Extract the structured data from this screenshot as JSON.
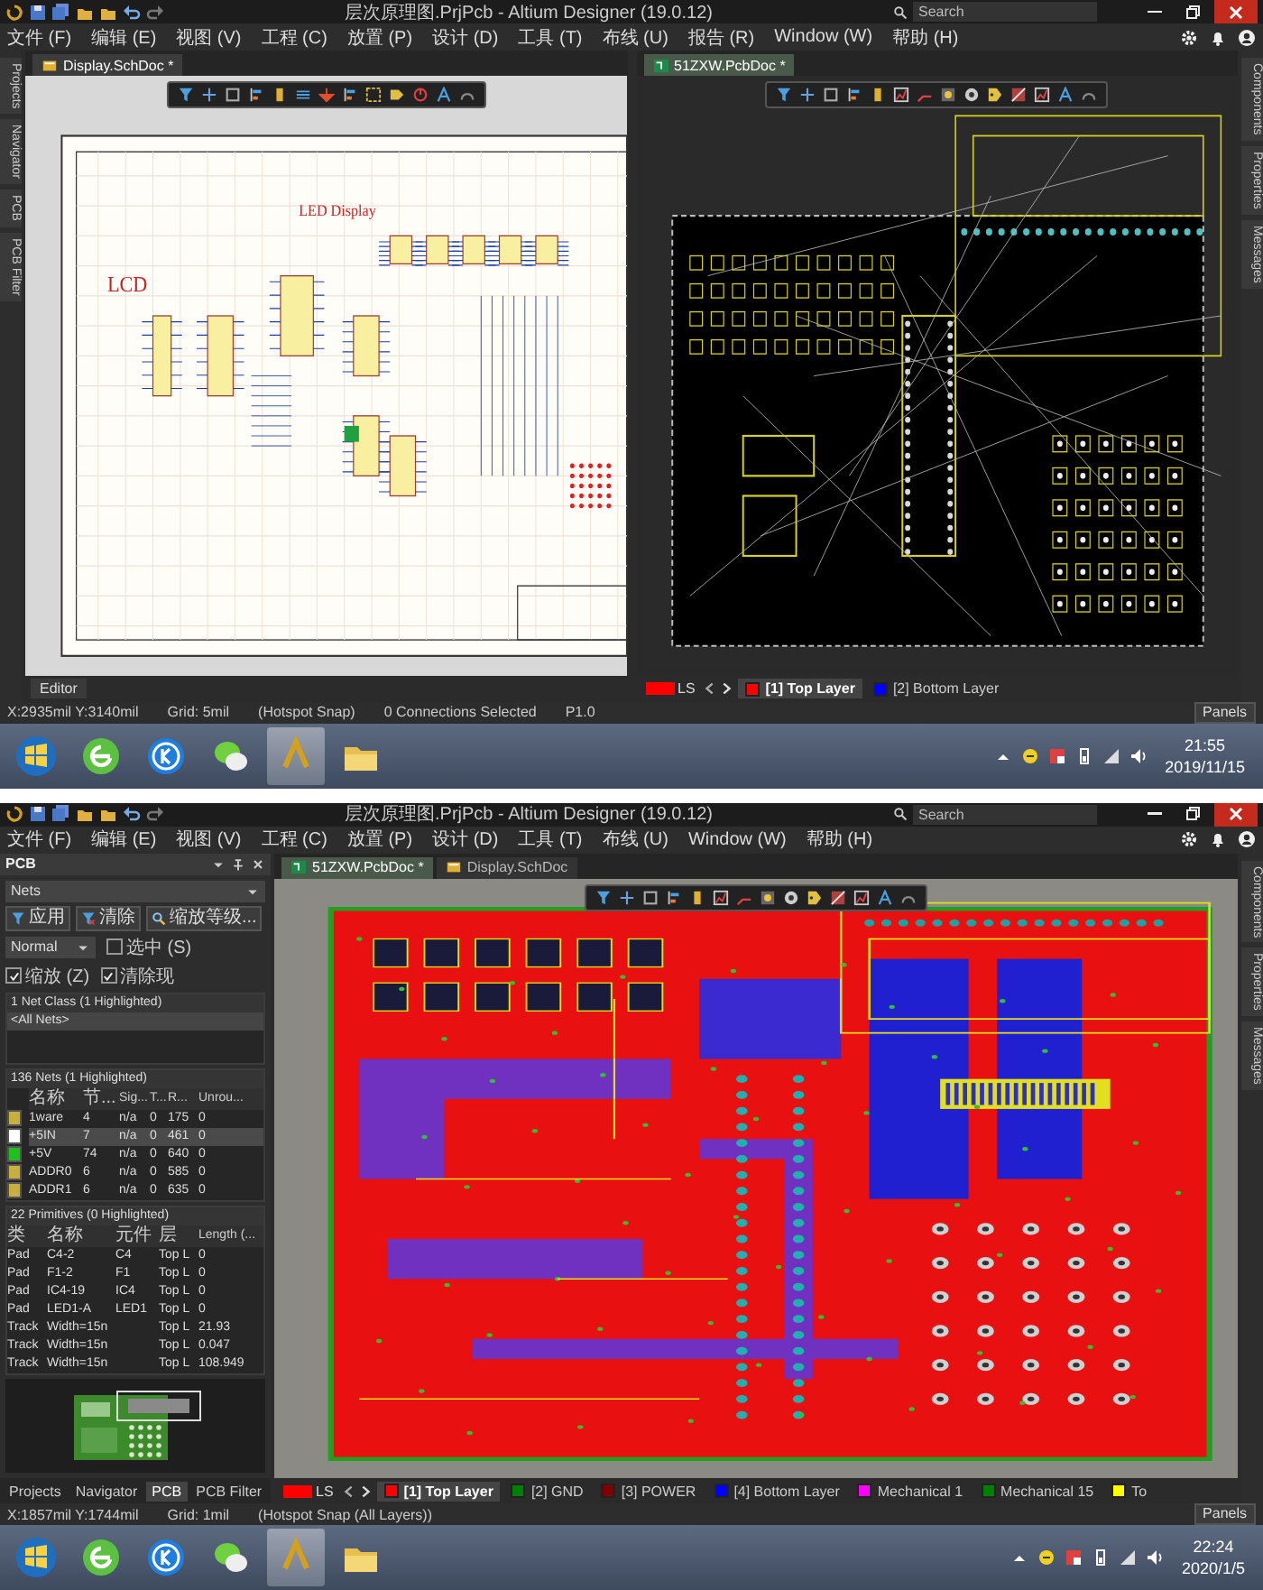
{
  "screens": [
    {
      "title": "层次原理图.PrjPcb - Altium Designer (19.0.12)",
      "search": {
        "placeholder": "Search"
      },
      "menus": [
        "文件 (F)",
        "编辑 (E)",
        "视图 (V)",
        "工程 (C)",
        "放置 (P)",
        "设计 (D)",
        "工具 (T)",
        "布线 (U)",
        "报告 (R)",
        "Window (W)",
        "帮助 (H)"
      ],
      "side_tabs_left": [
        "Projects",
        "Navigator",
        "PCB",
        "PCB Filter"
      ],
      "side_tabs_right": [
        "Components",
        "Properties",
        "Messages"
      ],
      "panes": [
        {
          "kind": "schematic",
          "focused": false,
          "tabs": [
            {
              "label": "Display.SchDoc *",
              "selected": true
            }
          ],
          "labels": [
            "LED Display",
            "LCD"
          ],
          "footer_tabs": [
            "Editor"
          ]
        },
        {
          "kind": "pcb_ratsnest",
          "focused": true,
          "tabs": [
            {
              "label": "51ZXW.PcbDoc *",
              "selected": true
            }
          ],
          "layer_set": "LS",
          "layers": [
            {
              "label": "[1] Top Layer",
              "color": "#ff0000",
              "selected": true
            },
            {
              "label": "[2] Bottom Layer",
              "color": "#0000ff",
              "selected": false
            }
          ]
        }
      ],
      "status": [
        "X:2935mil Y:3140mil",
        "Grid: 5mil",
        "(Hotspot Snap)",
        "0 Connections Selected",
        "P1.0"
      ],
      "panels_button": "Panels",
      "clock": {
        "time": "21:55",
        "date": "2019/11/15"
      }
    },
    {
      "title": "层次原理图.PrjPcb - Altium Designer (19.0.12)",
      "search": {
        "placeholder": "Search"
      },
      "menus": [
        "文件 (F)",
        "编辑 (E)",
        "视图 (V)",
        "工程 (C)",
        "放置 (P)",
        "设计 (D)",
        "工具 (T)",
        "布线 (U)",
        "Window (W)",
        "帮助 (H)"
      ],
      "panel": {
        "title": "PCB",
        "mode_dropdown": "Nets",
        "buttons": [
          "应用",
          "清除",
          "缩放等级..."
        ],
        "filter_mode": "Normal",
        "options": [
          {
            "label": "选中 (S)",
            "checked": false
          },
          {
            "label": "缩放 (Z)",
            "checked": true
          },
          {
            "label": "清除现",
            "checked": true
          }
        ],
        "net_classes": {
          "header": "1 Net Class (1 Highlighted)",
          "items": [
            {
              "label": "<All Nets>",
              "selected": true
            }
          ]
        },
        "nets": {
          "header": "136 Nets (1 Highlighted)",
          "columns": [
            "名称",
            "节...",
            "Sig...",
            "T...",
            "R...",
            "Unrou..."
          ],
          "rows": [
            {
              "color": "#c8b040",
              "selected": false,
              "cells": [
                "1ware",
                "4",
                "n/a",
                "0",
                "175",
                "0"
              ]
            },
            {
              "color": "#ffffff",
              "selected": true,
              "cells": [
                "+5IN",
                "7",
                "n/a",
                "0",
                "461",
                "0"
              ]
            },
            {
              "color": "#20c020",
              "selected": false,
              "cells": [
                "+5V",
                "74",
                "n/a",
                "0",
                "640",
                "0"
              ]
            },
            {
              "color": "#c8b040",
              "selected": false,
              "cells": [
                "ADDR0",
                "6",
                "n/a",
                "0",
                "585",
                "0"
              ]
            },
            {
              "color": "#c8b040",
              "selected": false,
              "cells": [
                "ADDR1",
                "6",
                "n/a",
                "0",
                "635",
                "0"
              ]
            }
          ]
        },
        "primitives": {
          "header": "22 Primitives (0 Highlighted)",
          "columns": [
            "类",
            "名称",
            "元件",
            "层",
            "Length (..."
          ],
          "rows": [
            [
              "Pad",
              "C4-2",
              "C4",
              "Top L",
              "0"
            ],
            [
              "Pad",
              "F1-2",
              "F1",
              "Top L",
              "0"
            ],
            [
              "Pad",
              "IC4-19",
              "IC4",
              "Top L",
              "0"
            ],
            [
              "Pad",
              "LED1-A",
              "LED1",
              "Top L",
              "0"
            ],
            [
              "Track",
              "Width=15n",
              "",
              "Top L",
              "21.93"
            ],
            [
              "Track",
              "Width=15n",
              "",
              "Top L",
              "0.047"
            ],
            [
              "Track",
              "Width=15n",
              "",
              "Top L",
              "108.949"
            ]
          ]
        },
        "tabs": [
          {
            "label": "Projects",
            "selected": false
          },
          {
            "label": "Navigator",
            "selected": false
          },
          {
            "label": "PCB",
            "selected": true
          },
          {
            "label": "PCB Filter",
            "selected": false
          }
        ]
      },
      "side_tabs_right": [
        "Components",
        "Properties",
        "Messages"
      ],
      "panes": [
        {
          "kind": "pcb_routed",
          "focused": true,
          "tabs": [
            {
              "label": "51ZXW.PcbDoc *",
              "selected": true
            },
            {
              "label": "Display.SchDoc",
              "selected": false
            }
          ],
          "layer_set": "LS",
          "layers": [
            {
              "label": "[1] Top Layer",
              "color": "#ff0000",
              "selected": true
            },
            {
              "label": "[2] GND",
              "color": "#008000",
              "selected": false
            },
            {
              "label": "[3] POWER",
              "color": "#800000",
              "selected": false
            },
            {
              "label": "[4] Bottom Layer",
              "color": "#0000ff",
              "selected": false
            },
            {
              "label": "Mechanical 1",
              "color": "#ff00ff",
              "selected": false
            },
            {
              "label": "Mechanical 15",
              "color": "#008000",
              "selected": false
            },
            {
              "label": "To",
              "color": "#ffff00",
              "selected": false
            }
          ]
        }
      ],
      "status": [
        "X:1857mil Y:1744mil",
        "Grid: 1mil",
        "(Hotspot Snap (All Layers))"
      ],
      "panels_button": "Panels",
      "clock": {
        "time": "22:24",
        "date": "2020/1/5"
      }
    }
  ]
}
